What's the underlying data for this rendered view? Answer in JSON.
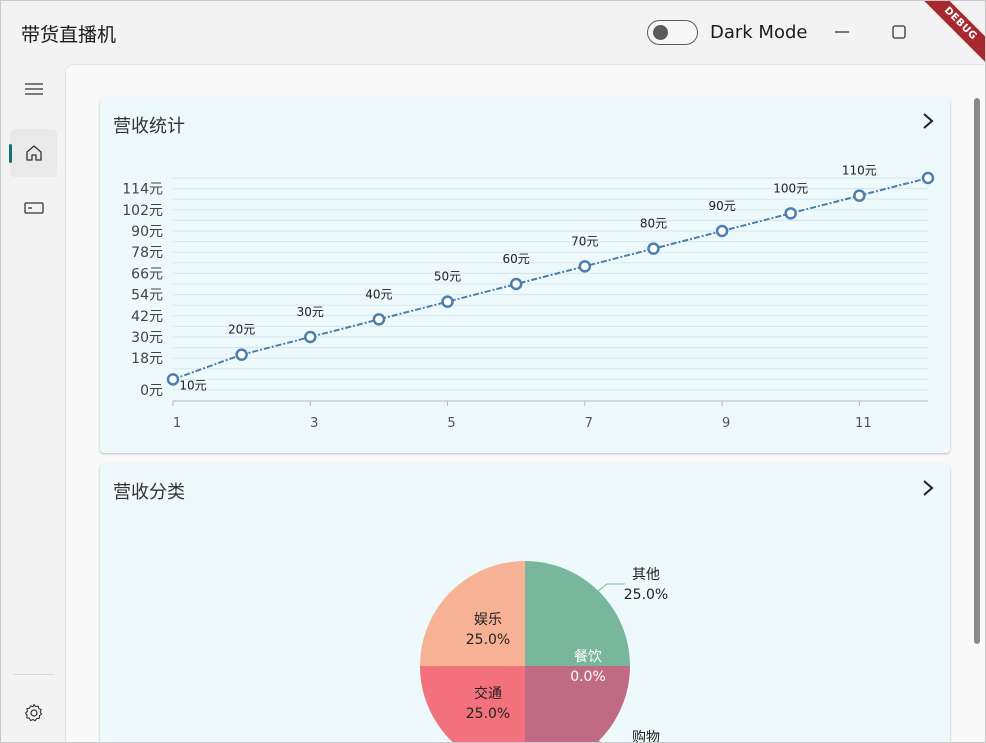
{
  "app": {
    "title": "带货直播机",
    "dark_mode_label": "Dark Mode",
    "debug_banner": "DEBUG"
  },
  "nav": {
    "items": [
      {
        "icon": "menu-icon"
      },
      {
        "icon": "home-icon",
        "active": true
      },
      {
        "icon": "card-icon"
      },
      {
        "icon": "settings-icon"
      }
    ]
  },
  "revenue_card": {
    "title": "营收统计"
  },
  "category_card": {
    "title": "营收分类"
  },
  "chart_data": [
    {
      "type": "line",
      "title": "营收统计",
      "x": [
        1,
        2,
        3,
        4,
        5,
        6,
        7,
        8,
        9,
        10,
        11,
        12
      ],
      "series": [
        {
          "values": [
            6,
            20,
            30,
            40,
            50,
            60,
            70,
            80,
            90,
            100,
            110,
            120
          ],
          "data_labels": [
            "10元",
            "20元",
            "30元",
            "40元",
            "50元",
            "60元",
            "70元",
            "80元",
            "90元",
            "100元",
            "110元",
            ""
          ],
          "color": "#4b7fae"
        }
      ],
      "x_ticks": [
        "1",
        "3",
        "5",
        "7",
        "9",
        "11"
      ],
      "y_ticks": [
        "0元",
        "18元",
        "30元",
        "42元",
        "54元",
        "66元",
        "78元",
        "90元",
        "102元",
        "114元"
      ],
      "xlim": [
        1,
        12
      ],
      "ylim": [
        0,
        120
      ],
      "grid": true
    },
    {
      "type": "pie",
      "title": "营收分类",
      "slices": [
        {
          "label": "其他",
          "percent": "25.0%",
          "value": 25,
          "color": "#78b79b"
        },
        {
          "label": "购物",
          "percent": "25.0%",
          "value": 25,
          "color": "#c06b84"
        },
        {
          "label": "交通",
          "percent": "25.0%",
          "value": 25,
          "color": "#f2717c"
        },
        {
          "label": "娱乐",
          "percent": "25.0%",
          "value": 25,
          "color": "#f7b295"
        },
        {
          "label": "餐饮",
          "percent": "0.0%",
          "value": 0,
          "color": "#78b79b"
        }
      ]
    }
  ]
}
